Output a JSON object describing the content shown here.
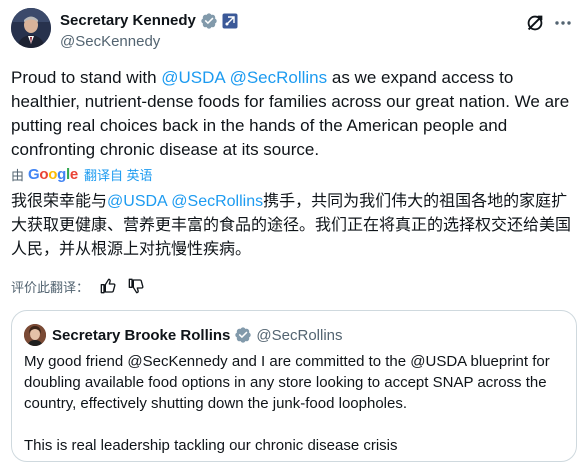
{
  "post": {
    "author_name": "Secretary Kennedy",
    "author_handle": "@SecKennedy",
    "text_segments": [
      {
        "text": "Proud to stand with ",
        "mention": false
      },
      {
        "text": "@USDA",
        "mention": true
      },
      {
        "text": " ",
        "mention": false
      },
      {
        "text": "@SecRollins",
        "mention": true
      },
      {
        "text": " as we expand access to healthier, nutrient-dense foods for families across our great nation. We are putting real choices back in the hands of the American people and confronting chronic disease at its source.",
        "mention": false
      }
    ],
    "verified_icon": "verified-check-icon",
    "gov_icon": "government-badge-icon"
  },
  "translation": {
    "by_label": "由",
    "provider": "Google",
    "action_label": "翻译自 英语",
    "text_segments": [
      {
        "text": "我很荣幸能与",
        "mention": false
      },
      {
        "text": "@USDA",
        "mention": true
      },
      {
        "text": " ",
        "mention": false
      },
      {
        "text": "@SecRollins",
        "mention": true
      },
      {
        "text": "携手，共同为我们伟大的祖国各地的家庭扩大获取更健康、营养更丰富的食品的途径。我们正在将真正的选择权交还给美国人民，并从根源上对抗慢性疾病。",
        "mention": false
      }
    ],
    "rate_label": "评价此翻译："
  },
  "quote": {
    "author_name": "Secretary Brooke Rollins",
    "author_handle": "@SecRollins",
    "paragraph1": "My good friend @SecKennedy and I are committed to the @USDA blueprint for doubling available food options in any store looking to accept SNAP across the country, effectively shutting down the junk-food loopholes.",
    "paragraph2": "This is real leadership tackling our chronic disease crisis"
  },
  "colors": {
    "link": "#1d9bf0",
    "text": "#0f1419",
    "secondary": "#536471",
    "border": "#cfd9de"
  }
}
